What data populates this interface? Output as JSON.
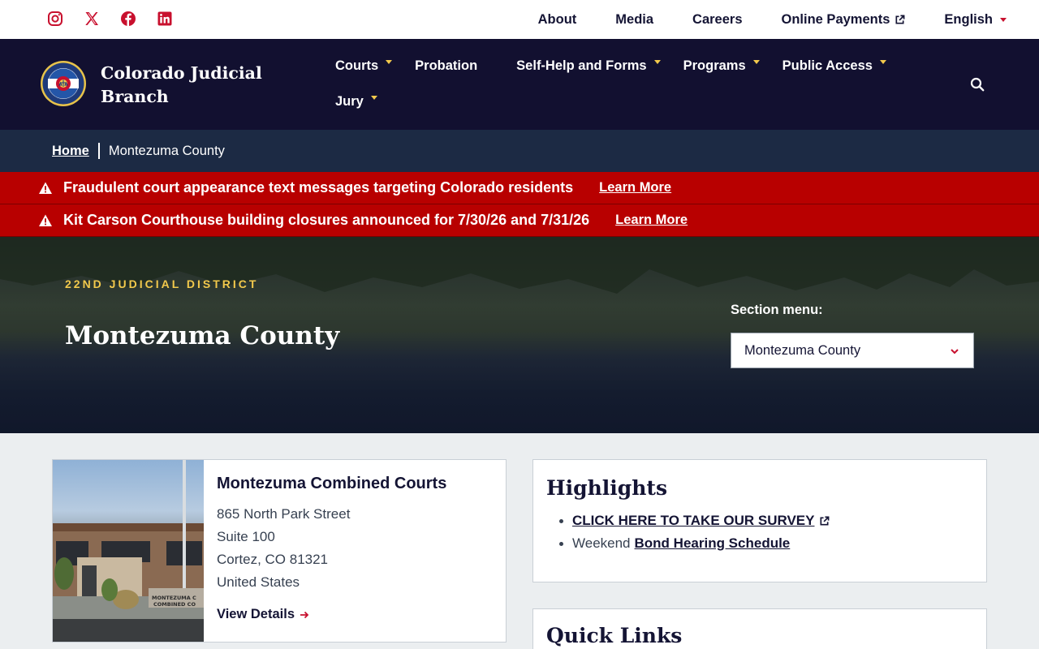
{
  "utility": {
    "social": [
      {
        "icon": "instagram-icon"
      },
      {
        "icon": "x-icon"
      },
      {
        "icon": "facebook-icon"
      },
      {
        "icon": "linkedin-icon"
      }
    ],
    "links": [
      {
        "label": "About"
      },
      {
        "label": "Media"
      },
      {
        "label": "Careers"
      },
      {
        "label": "Online Payments"
      },
      {
        "label": "English"
      }
    ]
  },
  "header": {
    "brand": "Colorado Judicial Branch",
    "nav": [
      {
        "label": "Courts"
      },
      {
        "label": "Probation"
      },
      {
        "label": "Self-Help and Forms"
      },
      {
        "label": "Programs"
      },
      {
        "label": "Public Access"
      },
      {
        "label": "Jury"
      }
    ]
  },
  "breadcrumb": {
    "home": "Home",
    "current": "Montezuma County"
  },
  "alerts": [
    {
      "message": "Fraudulent court appearance text messages targeting Colorado residents",
      "link": "Learn More"
    },
    {
      "message": "Kit Carson Courthouse building closures announced for 7/30/26 and 7/31/26",
      "link": "Learn More"
    }
  ],
  "hero": {
    "eyebrow": "22ND JUDICIAL DISTRICT",
    "title": "Montezuma County",
    "section_menu_label": "Section menu:",
    "section_menu_value": "Montezuma County"
  },
  "court": {
    "name": "Montezuma Combined Courts",
    "address1": "865 North Park Street",
    "address2": "Suite 100",
    "city": "Cortez, CO 81321",
    "country": "United States",
    "view_details": "View Details",
    "photo_sign": "MONTEZUMA COMBINED COURTS"
  },
  "highlights": {
    "title": "Highlights",
    "survey_link": "CLICK HERE TO TAKE OUR SURVEY",
    "bond_prefix": "Weekend",
    "bond_link": "Bond Hearing Schedule"
  },
  "quick_links": {
    "title": "Quick Links"
  },
  "colors": {
    "navy": "#121030",
    "crumb": "#1c2a44",
    "alert_red": "#b80000",
    "gold": "#f2c94c",
    "accent_red": "#c8102e"
  }
}
